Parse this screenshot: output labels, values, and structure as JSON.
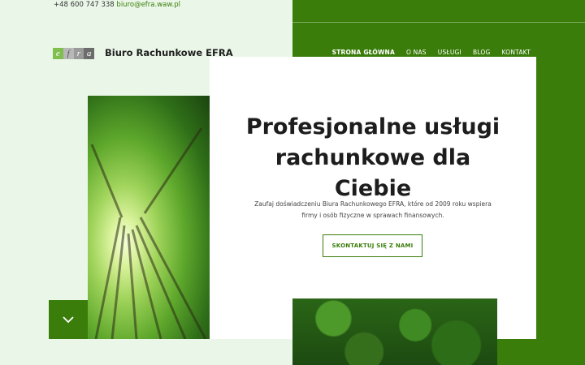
{
  "topbar": {
    "phone": "+48 600 747 338",
    "email": "biuro@efra.waw.pl"
  },
  "logo": {
    "letters": [
      "e",
      "f",
      "r",
      "a"
    ]
  },
  "brand": {
    "name": "Biuro Rachunkowe EFRA"
  },
  "nav": {
    "items": [
      "STRONA GŁÓWNA",
      "O NAS",
      "USŁUGI",
      "BLOG",
      "KONTAKT"
    ]
  },
  "hero": {
    "title": "Profesjonalne usługi rachunkowe dla Ciebie",
    "description": "Zaufaj doświadczeniu Biura Rachunkowego EFRA, które od 2009 roku wspiera firmy i osób fizyczne w sprawach finansowych.",
    "cta": "SKONTAKTUJ SIĘ Z NAMI"
  },
  "colors": {
    "brand_green": "#3a7d0a",
    "light_bg": "#eaf7e8"
  },
  "icons": {
    "scroll": "chevron-down-icon"
  }
}
